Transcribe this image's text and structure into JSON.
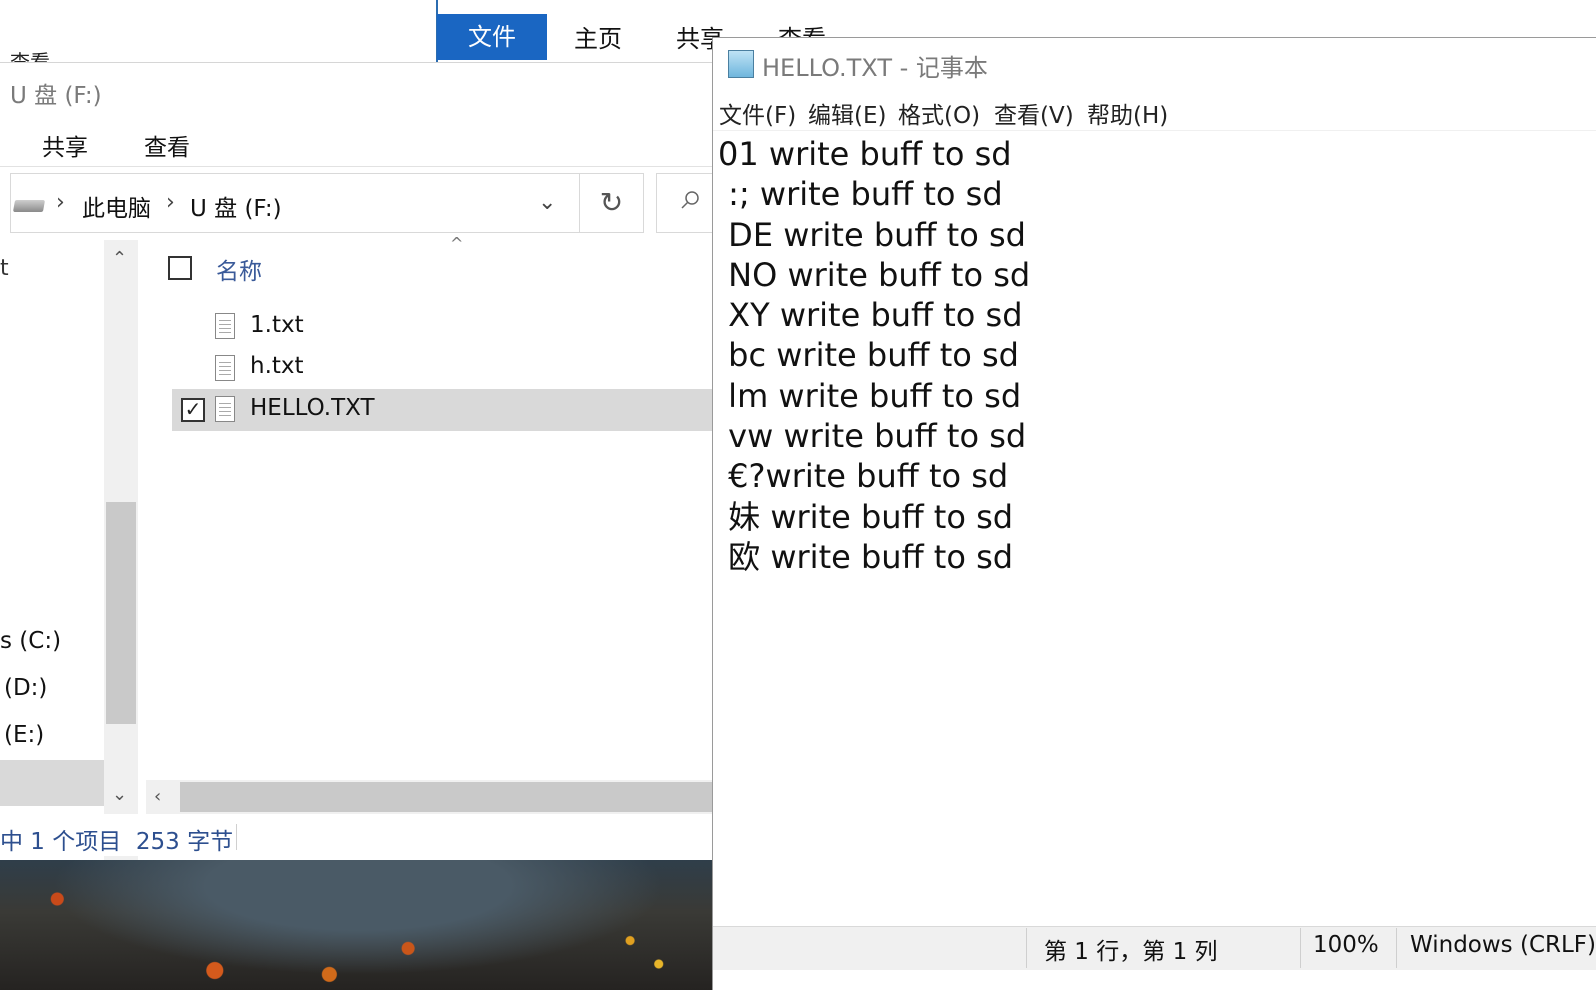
{
  "background_window": {
    "tab_fragment": "查看"
  },
  "ribbon2": {
    "tabs": [
      "文件",
      "主页",
      "共享",
      "查看"
    ]
  },
  "explorer": {
    "title": "U 盘 (F:)",
    "tabs": [
      "共享",
      "查看"
    ],
    "breadcrumb": [
      "此电脑",
      "U 盘 (F:)"
    ],
    "refresh_glyph": "↻",
    "column_header": "名称",
    "files": [
      {
        "name": "1.txt",
        "selected": false
      },
      {
        "name": "h.txt",
        "selected": false
      },
      {
        "name": "HELLO.TXT",
        "selected": true
      }
    ],
    "nav_items": [
      "s (C:)",
      "(D:)",
      "(E:)"
    ],
    "nav_fragment": "t",
    "status": "中 1 个项目  253 字节"
  },
  "notepad": {
    "title": "HELLO.TXT - 记事本",
    "menu": [
      "文件(F)",
      "编辑(E)",
      "格式(O)",
      "查看(V)",
      "帮助(H)"
    ],
    "content": "01 write buff to sd\n :; write buff to sd\n DE write buff to sd\n NO write buff to sd\n XY write buff to sd\n bc write buff to sd\n lm write buff to sd\n vw write buff to sd\n €?write buff to sd\n 妹 write buff to sd\n 欧 write buff to sd",
    "status": {
      "position": "第 1 行，第 1 列",
      "zoom": "100%",
      "line_ending": "Windows (CRLF)"
    }
  },
  "colors": {
    "accent": "#1a66c2",
    "selection": "#d9d9d9",
    "status_text": "#2d4f8f"
  }
}
